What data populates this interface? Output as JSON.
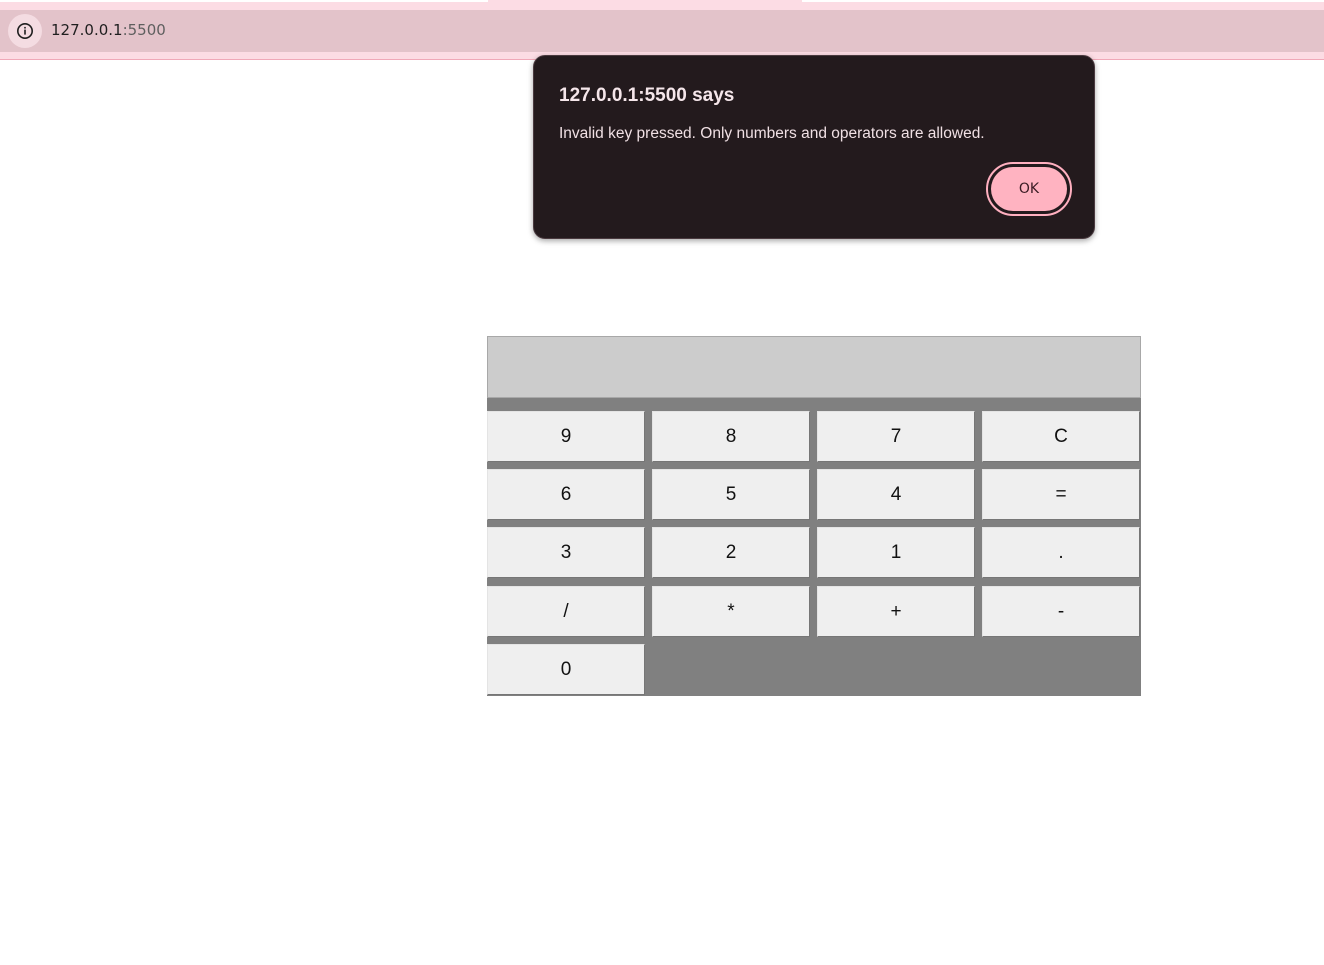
{
  "browser": {
    "url_host": "127.0.0.1",
    "url_port": ":5500",
    "site_info_icon": "info-icon"
  },
  "alert": {
    "title": "127.0.0.1:5500 says",
    "message": "Invalid key pressed. Only numbers and operators are allowed.",
    "ok_label": "OK"
  },
  "calculator": {
    "display_value": "",
    "keys": [
      "9",
      "8",
      "7",
      "C",
      "6",
      "5",
      "4",
      "=",
      "3",
      "2",
      "1",
      ".",
      "/",
      "*",
      "+",
      "-",
      "0"
    ]
  },
  "colors": {
    "chrome_pink": "#fcdce4",
    "address_bar": "#e3c3ca",
    "dialog_background": "#231a1d",
    "ok_button": "#ffb3c1",
    "calculator_body": "#808080",
    "display_background": "#cccccc",
    "key_background": "#efefef"
  }
}
